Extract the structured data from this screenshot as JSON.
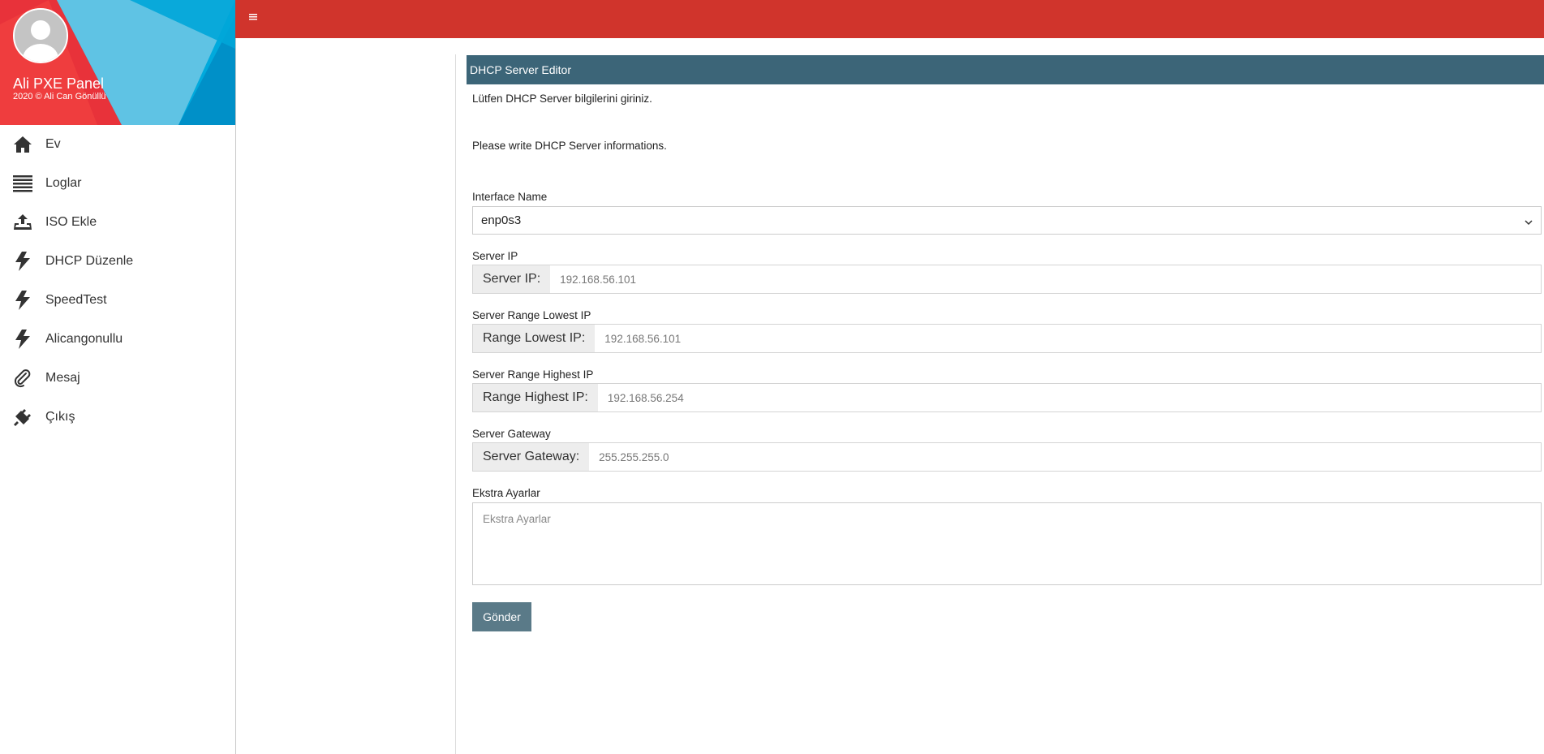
{
  "sidebar": {
    "profile": {
      "name": "Ali PXE Panel",
      "copyright": "2020 © Ali Can Gönüllü"
    },
    "items": [
      {
        "label": "Ev",
        "icon": "home-icon"
      },
      {
        "label": "Loglar",
        "icon": "list-icon"
      },
      {
        "label": "ISO Ekle",
        "icon": "upload-icon"
      },
      {
        "label": "DHCP Düzenle",
        "icon": "bolt-icon"
      },
      {
        "label": "SpeedTest",
        "icon": "bolt-icon"
      },
      {
        "label": "Alicangonullu",
        "icon": "bolt-icon"
      },
      {
        "label": "Mesaj",
        "icon": "paperclip-icon"
      },
      {
        "label": "Çıkış",
        "icon": "plug-icon"
      }
    ]
  },
  "topbar": {
    "color": "#d0342c",
    "menu_icon": "hamburger-icon"
  },
  "card": {
    "title": "DHCP Server Editor",
    "intro_tr": "Lütfen DHCP Server bilgilerini giriniz.",
    "intro_en": "Please write DHCP Server informations."
  },
  "form": {
    "interface": {
      "label": "Interface Name",
      "value": "enp0s3"
    },
    "server_ip": {
      "label": "Server IP",
      "addon": "Server IP:",
      "placeholder": "192.168.56.101"
    },
    "range_low": {
      "label": "Server Range Lowest IP",
      "addon": "Range Lowest IP:",
      "placeholder": "192.168.56.101"
    },
    "range_high": {
      "label": "Server Range Highest IP",
      "addon": "Range Highest IP:",
      "placeholder": "192.168.56.254"
    },
    "gateway": {
      "label": "Server Gateway",
      "addon": "Server Gateway:",
      "placeholder": "255.255.255.0"
    },
    "extra": {
      "label": "Ekstra Ayarlar",
      "placeholder": "Ekstra Ayarlar"
    },
    "submit_label": "Gönder"
  }
}
